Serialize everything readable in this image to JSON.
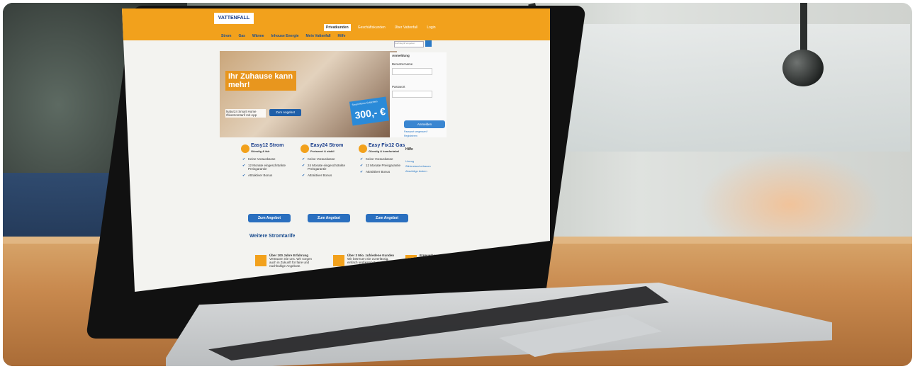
{
  "brand": {
    "logo_text": "VATTENFALL",
    "accent": "#F2A11C",
    "blue": "#1A4D8F"
  },
  "header": {
    "tabs": [
      "Privatkunden",
      "Geschäftskunden",
      "Über Vattenfall",
      "Login"
    ],
    "active_tab": "Privatkunden",
    "nav": [
      "Strom",
      "Gas",
      "Wärme",
      "Inhouse Energie",
      "Mein Vattenfall",
      "Hilfe"
    ],
    "search_placeholder": "Suchbegriff eingeben"
  },
  "hero": {
    "headline": "Ihr Zuhause kann mehr!",
    "subline": "Natur24 Smart Home Ökostromtarif mit App",
    "cta": "Zum Angebot",
    "badge_small": "Smart Home Gutschein",
    "badge_amount": "300,- €"
  },
  "login": {
    "title": "Anmeldung",
    "user_label": "Benutzername",
    "password_label": "Passwort",
    "submit": "Anmelden",
    "forgot": "Passwort vergessen?",
    "register": "Registrieren"
  },
  "offers": [
    {
      "title": "Easy12 Strom",
      "subtitle": "Günstig & fair",
      "features": [
        "Keine Vorauskasse",
        "12 Monate eingeschränkte Preisgarantie",
        "Attraktiver Bonus"
      ],
      "cta": "Zum Angebot"
    },
    {
      "title": "Easy24 Strom",
      "subtitle": "Preiswert & stabil",
      "features": [
        "Keine Vorauskasse",
        "24 Monate eingeschränkte Preisgarantie",
        "Attraktiver Bonus"
      ],
      "cta": "Zum Angebot"
    },
    {
      "title": "Easy Fix12 Gas",
      "subtitle": "Günstig & komfortabel",
      "features": [
        "Keine Vorauskasse",
        "12 Monate Preisgarantie",
        "Attraktiver Bonus"
      ],
      "cta": "Zum Angebot"
    }
  ],
  "help": {
    "title": "Hilfe",
    "links": [
      "Umzug",
      "Zählerstand erfassen",
      "Abschläge ändern"
    ]
  },
  "more_tariffs": "Weitere Stromtarife",
  "features": [
    {
      "title": "Über 100 Jahre Erfahrung",
      "text": "Vertrauen Sie uns. Wir sorgen auch in Zukunft für faire und nachhaltige Angebote."
    },
    {
      "title": "Über 3 Mio. zufriedene Kunden",
      "text": "Wir betreuen Sie zuverlässig, einfach und kompetent."
    },
    {
      "title": "Erneuerbare Energien",
      "text": "Wir haben das Klima und Sie die Energiekosten im Griff. Windkraft von Vattenfall."
    }
  ]
}
